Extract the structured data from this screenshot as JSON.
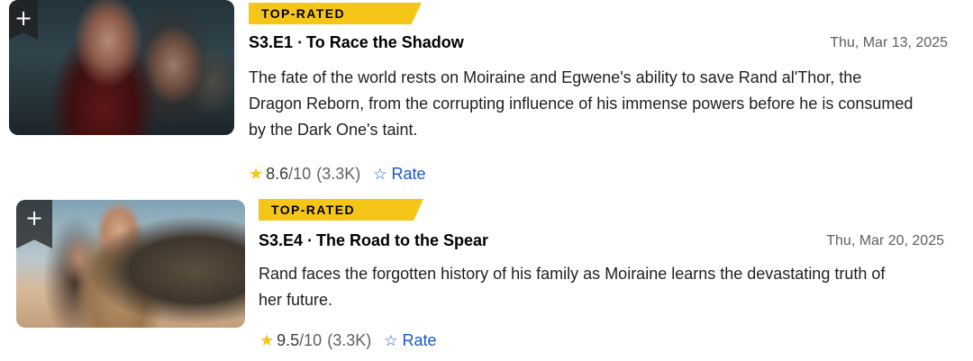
{
  "episodes": [
    {
      "badge": "TOP-RATED",
      "title": "S3.E1 ∙ To Race the Shadow",
      "air_date": "Thu, Mar 13, 2025",
      "plot": "The fate of the world rests on Moiraine and Egwene's ability to save Rand al'Thor, the Dragon Reborn, from the corrupting influence of his immense powers before he is consumed by the Dark One's taint.",
      "rating": "8.6",
      "rating_max": "/10",
      "votes": "(3.3K)",
      "rate_label": "Rate",
      "add_label": "+"
    },
    {
      "badge": "TOP-RATED",
      "title": "S3.E4 ∙ The Road to the Spear",
      "air_date": "Thu, Mar 20, 2025",
      "plot": "Rand faces the forgotten history of his family as Moiraine learns the devastating truth of her future.",
      "rating": "9.5",
      "rating_max": "/10",
      "votes": "(3.3K)",
      "rate_label": "Rate",
      "add_label": "+"
    }
  ],
  "icons": {
    "add": "plus-icon",
    "rating": "star-icon",
    "rate": "star-outline-icon"
  },
  "colors": {
    "badge": "#f5c518",
    "star": "#f5c518",
    "link": "#1a56c9",
    "ribbon": "#1f1f1f"
  }
}
